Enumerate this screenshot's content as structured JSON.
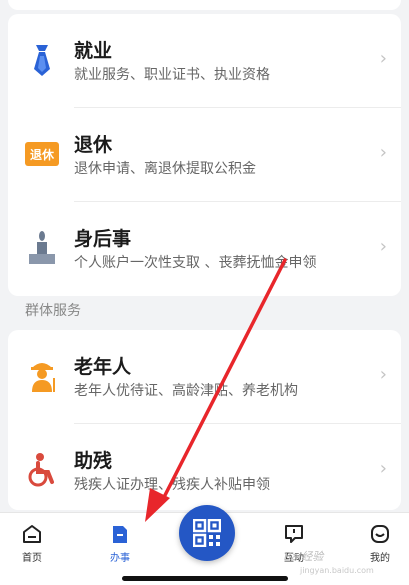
{
  "colors": {
    "accent": "#2a62d6",
    "qr_bg": "#2457c5",
    "orange": "#f59a23",
    "arrow": "#e8262b"
  },
  "services": [
    {
      "icon": "necktie-icon",
      "title": "就业",
      "desc": "就业服务、职业证书、执业资格"
    },
    {
      "icon": "retire-badge-icon",
      "badge": "退休",
      "title": "退休",
      "desc": "退休申请、离退休提取公积金"
    },
    {
      "icon": "memorial-candle-icon",
      "title": "身后事",
      "desc": "个人账户一次性支取 、丧葬抚恤金申领"
    }
  ],
  "section": {
    "label": "群体服务"
  },
  "groups": [
    {
      "icon": "elderly-person-icon",
      "title": "老年人",
      "desc": "老年人优待证、高龄津贴、养老机构"
    },
    {
      "icon": "wheelchair-icon",
      "title": "助残",
      "desc": "残疾人证办理、残疾人补贴申领"
    }
  ],
  "tabbar": {
    "home": "首页",
    "services": "办事",
    "interact": "互动",
    "mine": "我的"
  },
  "watermark": {
    "text": "Bai经验",
    "url": "jingyan.baidu.com"
  }
}
